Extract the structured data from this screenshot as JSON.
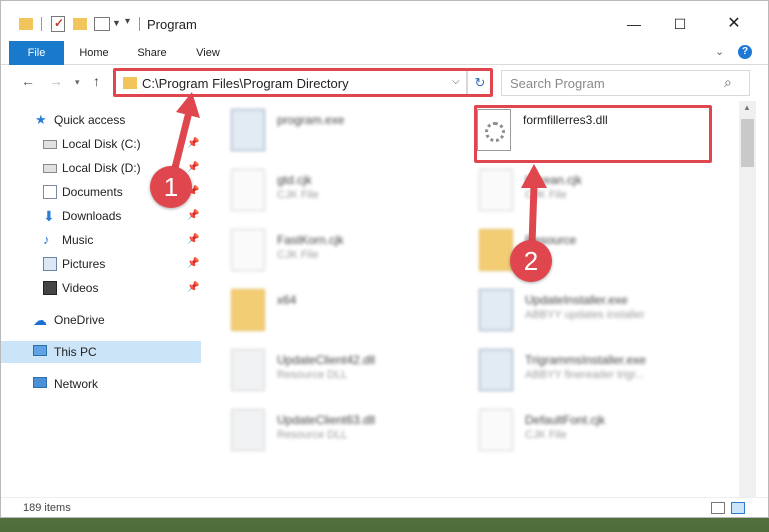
{
  "window": {
    "title": "Program",
    "controls": {
      "minimize": "—",
      "maximize": "☐",
      "close": "✕"
    }
  },
  "ribbon": {
    "tabs": [
      "File",
      "Home",
      "Share",
      "View"
    ],
    "help": "?"
  },
  "address": {
    "path": "C:\\Program Files\\Program Directory",
    "search_placeholder": "Search Program"
  },
  "sidebar": {
    "quick_access": "Quick access",
    "items": [
      {
        "label": "Local Disk (C:)",
        "icon": "drive-icon",
        "pinned": true
      },
      {
        "label": "Local Disk (D:)",
        "icon": "drive-icon",
        "pinned": true
      },
      {
        "label": "Documents",
        "icon": "documents-icon",
        "pinned": true
      },
      {
        "label": "Downloads",
        "icon": "download-arrow-icon",
        "pinned": true
      },
      {
        "label": "Music",
        "icon": "music-note-icon",
        "pinned": true
      },
      {
        "label": "Pictures",
        "icon": "pictures-icon",
        "pinned": true
      },
      {
        "label": "Videos",
        "icon": "film-icon",
        "pinned": true
      }
    ],
    "onedrive": "OneDrive",
    "this_pc": "This PC",
    "network": "Network"
  },
  "files": [
    {
      "name": "program.exe",
      "type": "",
      "kind": "exe"
    },
    {
      "name": "formfillerres3.dll",
      "type": "",
      "kind": "dll"
    },
    {
      "name": "gtd.cjk",
      "type": "CJK File",
      "kind": "file"
    },
    {
      "name": "Korean.cjk",
      "type": "CJK File",
      "kind": "file"
    },
    {
      "name": "FastKorn.cjk",
      "type": "CJK File",
      "kind": "file"
    },
    {
      "name": "Resource",
      "type": "",
      "kind": "folder"
    },
    {
      "name": "x64",
      "type": "",
      "kind": "folder"
    },
    {
      "name": "UpdateInstaller.exe",
      "type": "ABBYY updates installer",
      "kind": "exe"
    },
    {
      "name": "UpdateClient42.dll",
      "type": "Resource DLL",
      "kind": "dll"
    },
    {
      "name": "TrigrammsInstaller.exe",
      "type": "ABBYY finereader trigr...",
      "kind": "exe"
    },
    {
      "name": "UpdateClient63.dll",
      "type": "Resource DLL",
      "kind": "dll"
    },
    {
      "name": "DefaultFont.cjk",
      "type": "CJK File",
      "kind": "file"
    }
  ],
  "status": {
    "items": "189 items"
  },
  "annotations": {
    "step1": "1",
    "step2": "2",
    "color": "#e0464e"
  }
}
